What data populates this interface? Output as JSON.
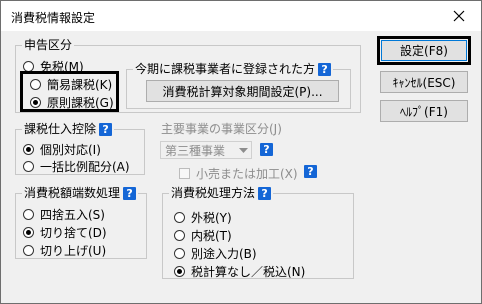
{
  "window": {
    "title": "消費税情報設定",
    "close_icon": "close-icon"
  },
  "colors": {
    "help_icon": "#1466d6",
    "default_button_border": "#0078d7"
  },
  "tax_class": {
    "title": "申告区分",
    "options": [
      {
        "label": "免税(M)",
        "checked": false
      },
      {
        "label": "簡易課税(K)",
        "checked": false
      },
      {
        "label": "原則課税(G)",
        "checked": true
      }
    ],
    "registered": {
      "title": "今期に課税事業者に登録された方",
      "help": "?",
      "button_label": "消費税計算対象期間設定(P)..."
    }
  },
  "input_deduction": {
    "title": "課税仕入控除",
    "help": "?",
    "options": [
      {
        "label": "個別対応(I)",
        "checked": true
      },
      {
        "label": "一括比例配分(A)",
        "checked": false
      }
    ]
  },
  "business_type": {
    "title": "主要事業の事業区分(J)",
    "selected": "第三種事業",
    "help": "?",
    "retail_label": "小売または加工(X)",
    "retail_help": "?"
  },
  "rounding": {
    "title": "消費税額端数処理",
    "help": "?",
    "options": [
      {
        "label": "四捨五入(S)",
        "checked": false
      },
      {
        "label": "切り捨て(D)",
        "checked": true
      },
      {
        "label": "切り上げ(U)",
        "checked": false
      }
    ]
  },
  "method": {
    "title": "消費税処理方法",
    "help": "?",
    "options": [
      {
        "label": "外税(Y)",
        "checked": false
      },
      {
        "label": "内税(T)",
        "checked": false
      },
      {
        "label": "別途入力(B)",
        "checked": false
      },
      {
        "label": "税計算なし／税込(N)",
        "checked": true
      }
    ]
  },
  "buttons": {
    "ok": "設定(F8)",
    "cancel": "ｷｬﾝｾﾙ(ESC)",
    "help": "ﾍﾙﾌﾟ(F1)"
  }
}
